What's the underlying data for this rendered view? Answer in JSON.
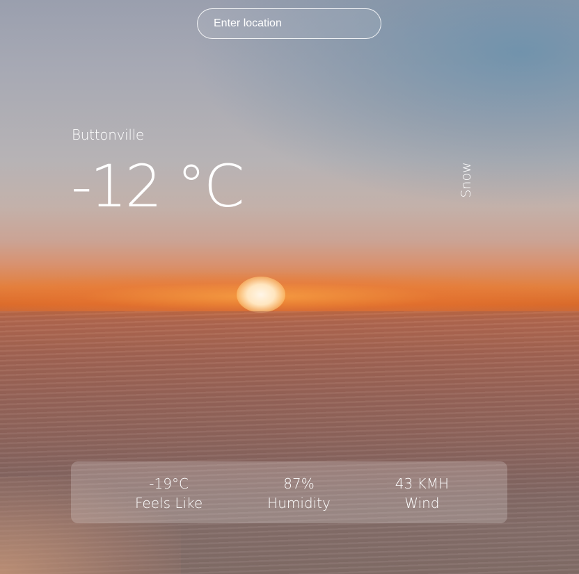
{
  "search": {
    "placeholder": "Enter location",
    "value": ""
  },
  "weather": {
    "city": "Buttonville",
    "temperature": "-12 °C",
    "condition": "Snow"
  },
  "stats": {
    "feels_like": {
      "value": "-19°C",
      "label": "Feels Like"
    },
    "humidity": {
      "value": "87%",
      "label": "Humidity"
    },
    "wind": {
      "value": "43 KMH",
      "label": "Wind"
    }
  },
  "background": {
    "scene": "sunset-beach-photo"
  }
}
